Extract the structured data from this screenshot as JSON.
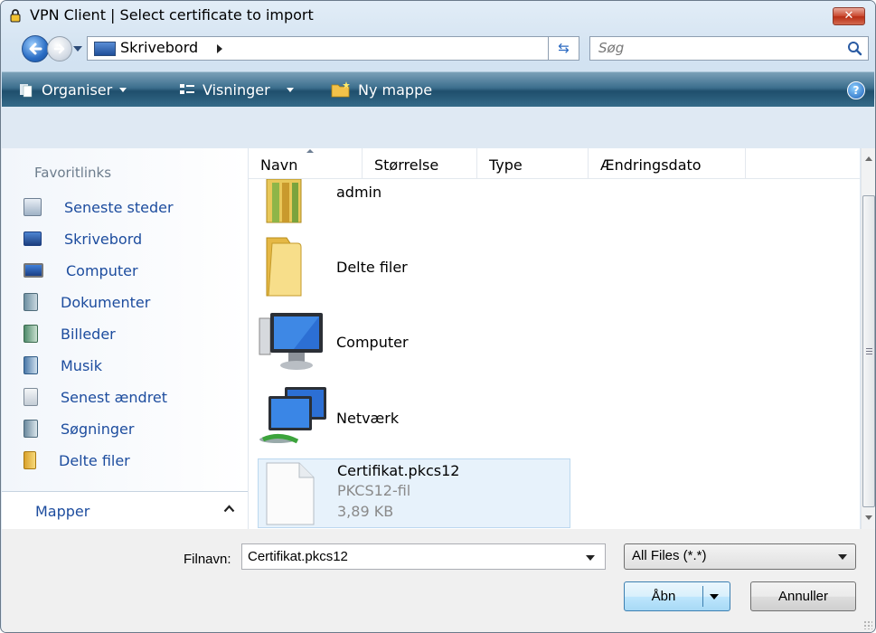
{
  "window": {
    "title": "VPN Client  |  Select certificate to import",
    "close_glyph": "✕"
  },
  "navigation": {
    "address": "Skrivebord",
    "search_placeholder": "Søg",
    "refresh_glyph": "⇆"
  },
  "toolbar": {
    "organize": "Organiser",
    "views": "Visninger",
    "new_folder": "Ny mappe",
    "help_glyph": "?"
  },
  "sidebar": {
    "favorites_heading": "Favoritlinks",
    "items": [
      {
        "label": "Seneste steder",
        "icon": "recent-places-icon"
      },
      {
        "label": "Skrivebord",
        "icon": "desktop-icon"
      },
      {
        "label": "Computer",
        "icon": "computer-icon"
      },
      {
        "label": "Dokumenter",
        "icon": "documents-icon"
      },
      {
        "label": "Billeder",
        "icon": "pictures-icon"
      },
      {
        "label": "Musik",
        "icon": "music-icon"
      },
      {
        "label": "Senest ændret",
        "icon": "recently-changed-icon"
      },
      {
        "label": "Søgninger",
        "icon": "searches-icon"
      },
      {
        "label": "Delte filer",
        "icon": "shared-files-icon"
      }
    ],
    "folders_label": "Mapper"
  },
  "columns": [
    "Navn",
    "Størrelse",
    "Type",
    "Ændringsdato"
  ],
  "files": [
    {
      "name": "admin",
      "icon": "user-folder-icon"
    },
    {
      "name": "Delte filer",
      "icon": "folder-icon"
    },
    {
      "name": "Computer",
      "icon": "computer-icon"
    },
    {
      "name": "Netværk",
      "icon": "network-icon"
    },
    {
      "name": "Certifikat.pkcs12",
      "type": "PKCS12-fil",
      "size": "3,89 KB",
      "icon": "file-icon",
      "selected": true
    }
  ],
  "bottom": {
    "filename_label": "Filnavn:",
    "filename_value": "Certifikat.pkcs12",
    "filetype_value": "All Files (*.*)",
    "open_label": "Åbn",
    "cancel_label": "Annuller"
  },
  "colors": {
    "link_blue": "#1c4c9e",
    "toolbar_dark": "#1f4f6d",
    "selection_bg": "#e7f2fb"
  }
}
